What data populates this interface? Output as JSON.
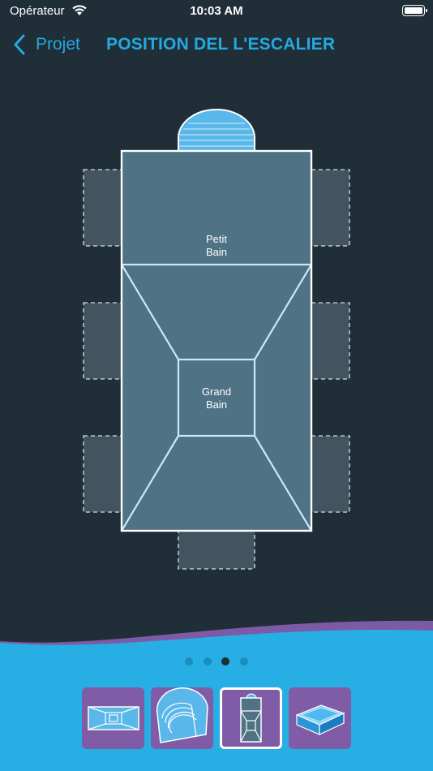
{
  "status_bar": {
    "carrier": "Opérateur",
    "time": "10:03 AM"
  },
  "nav": {
    "back_label": "Projet",
    "title": "POSITION DEL L'ESCALIER"
  },
  "pool": {
    "petit_bain_label": "Petit\nBain",
    "grand_bain_label": "Grand\nBain",
    "stair_slots": [
      "left-top",
      "left-middle",
      "left-bottom",
      "right-top",
      "right-middle",
      "right-bottom",
      "bottom-center"
    ],
    "selected_stair": "top-center-roman"
  },
  "pager": {
    "page_count": 4,
    "active_index": 2
  },
  "pool_types": [
    {
      "icon": "rectangle-pool-icon",
      "selected": false
    },
    {
      "icon": "roman-stair-pool-icon",
      "selected": false
    },
    {
      "icon": "pool-with-stair-icon",
      "selected": true
    },
    {
      "icon": "3d-pool-icon",
      "selected": false
    }
  ],
  "colors": {
    "background": "#1f2e37",
    "accent": "#24a9e1",
    "pool_fill": "#4f7285",
    "slot_fill": "#42545f",
    "stair_fill": "#5ab7ea",
    "wave_blue": "#27aee5",
    "wave_purple": "#7d5aa6",
    "button_purple": "#7f5ca5"
  }
}
